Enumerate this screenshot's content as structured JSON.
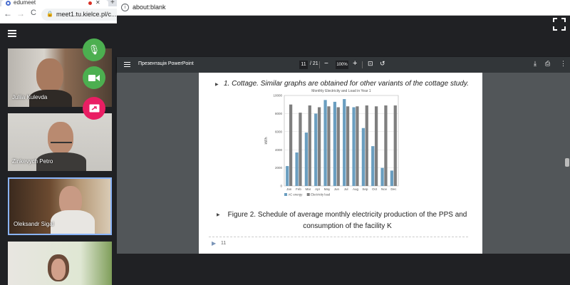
{
  "left_browser": {
    "tab_title": "edumeet",
    "url": "meet1.tu.kielce.pl/c...",
    "nav": {
      "back": "←",
      "forward": "→",
      "reload": "C"
    }
  },
  "meet": {
    "participants": [
      {
        "name": "Juliia Kulevda"
      },
      {
        "name": "Zinkevych Petro"
      },
      {
        "name": "Oleksandr Sigal"
      },
      {
        "name": ""
      }
    ],
    "colors": {
      "mic_button": "#4caf50",
      "camera_button": "#4caf50",
      "present_button": "#e91e63"
    }
  },
  "right_browser": {
    "url": "about:blank"
  },
  "pdf_viewer": {
    "title": "Презентація PowerPoint",
    "page": "11",
    "page_total": "/ 21",
    "zoom": "100%"
  },
  "slide": {
    "caption_top": "1. Cottage. Similar graphs are obtained for other variants of the cottage study.",
    "caption_bottom": "Figure 2. Schedule of average monthly electricity production of the PPS and consumption of the facility K",
    "slide_number": "11"
  },
  "chart_data": {
    "type": "bar",
    "title": "Monthly Electricity and Load in Year 1",
    "xlabel": "",
    "ylabel": "kWh",
    "ylim": [
      0,
      10000
    ],
    "yticks": [
      0,
      2000,
      4000,
      6000,
      8000,
      10000
    ],
    "grid": true,
    "legend_position": "bottom-left",
    "categories": [
      "Jan",
      "Feb",
      "Mar",
      "Apr",
      "May",
      "Jun",
      "Jul",
      "Aug",
      "Sep",
      "Oct",
      "Nov",
      "Dec"
    ],
    "series": [
      {
        "name": "AC energy",
        "color": "#6a9ec0",
        "values": [
          2200,
          3700,
          5900,
          8000,
          9500,
          9300,
          9600,
          8700,
          6400,
          4400,
          2000,
          1700
        ]
      },
      {
        "name": "Electricity load",
        "color": "#7f7f7f",
        "values": [
          9000,
          8100,
          8900,
          8700,
          8800,
          8700,
          8800,
          8800,
          8900,
          8800,
          8900,
          8900
        ]
      }
    ]
  }
}
